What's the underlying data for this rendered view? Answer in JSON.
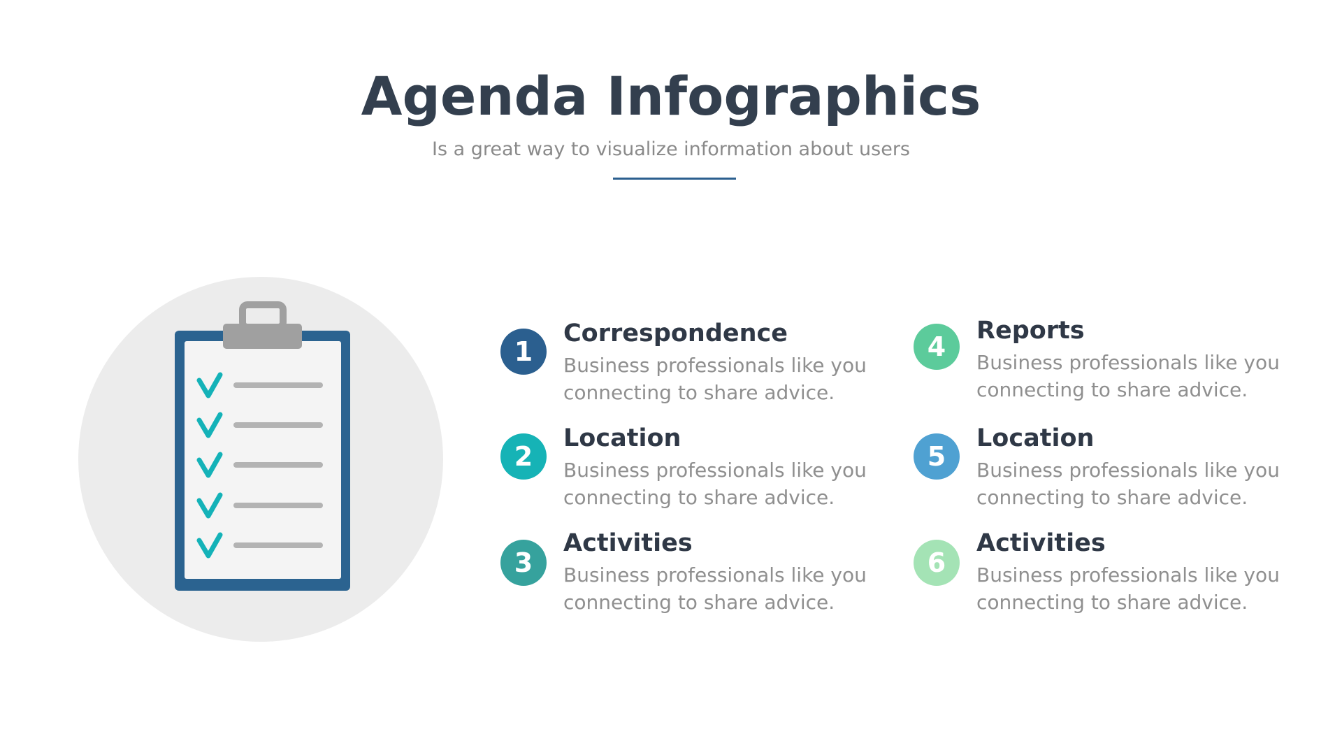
{
  "header": {
    "title": "Agenda Infographics",
    "subtitle": "Is a great way to visualize information about users"
  },
  "illustration": {
    "icon": "clipboard-checklist-icon",
    "circle_color": "#ececec",
    "board_color": "#2b6390",
    "paper_color": "#f4f4f4",
    "clip_color": "#a0a0a0",
    "check_color": "#14b2b8",
    "line_color": "#b3b3b3",
    "checked_items": 5
  },
  "items": [
    {
      "number": "1",
      "title": "Correspondence",
      "description": "Business professionals like you connecting to share advice.",
      "color": "#2b5f8f"
    },
    {
      "number": "2",
      "title": "Location",
      "description": "Business professionals like you connecting to share advice.",
      "color": "#16b3b6"
    },
    {
      "number": "3",
      "title": "Activities",
      "description": "Business professionals like you connecting to share advice.",
      "color": "#36a29d"
    },
    {
      "number": "4",
      "title": "Reports",
      "description": "Business professionals like you connecting to share advice.",
      "color": "#5ccb9b"
    },
    {
      "number": "5",
      "title": "Location",
      "description": "Business professionals like you connecting to share advice.",
      "color": "#4fa1d2"
    },
    {
      "number": "6",
      "title": "Activities",
      "description": "Business professionals like you connecting to share advice.",
      "color": "#a4e3b5"
    }
  ]
}
